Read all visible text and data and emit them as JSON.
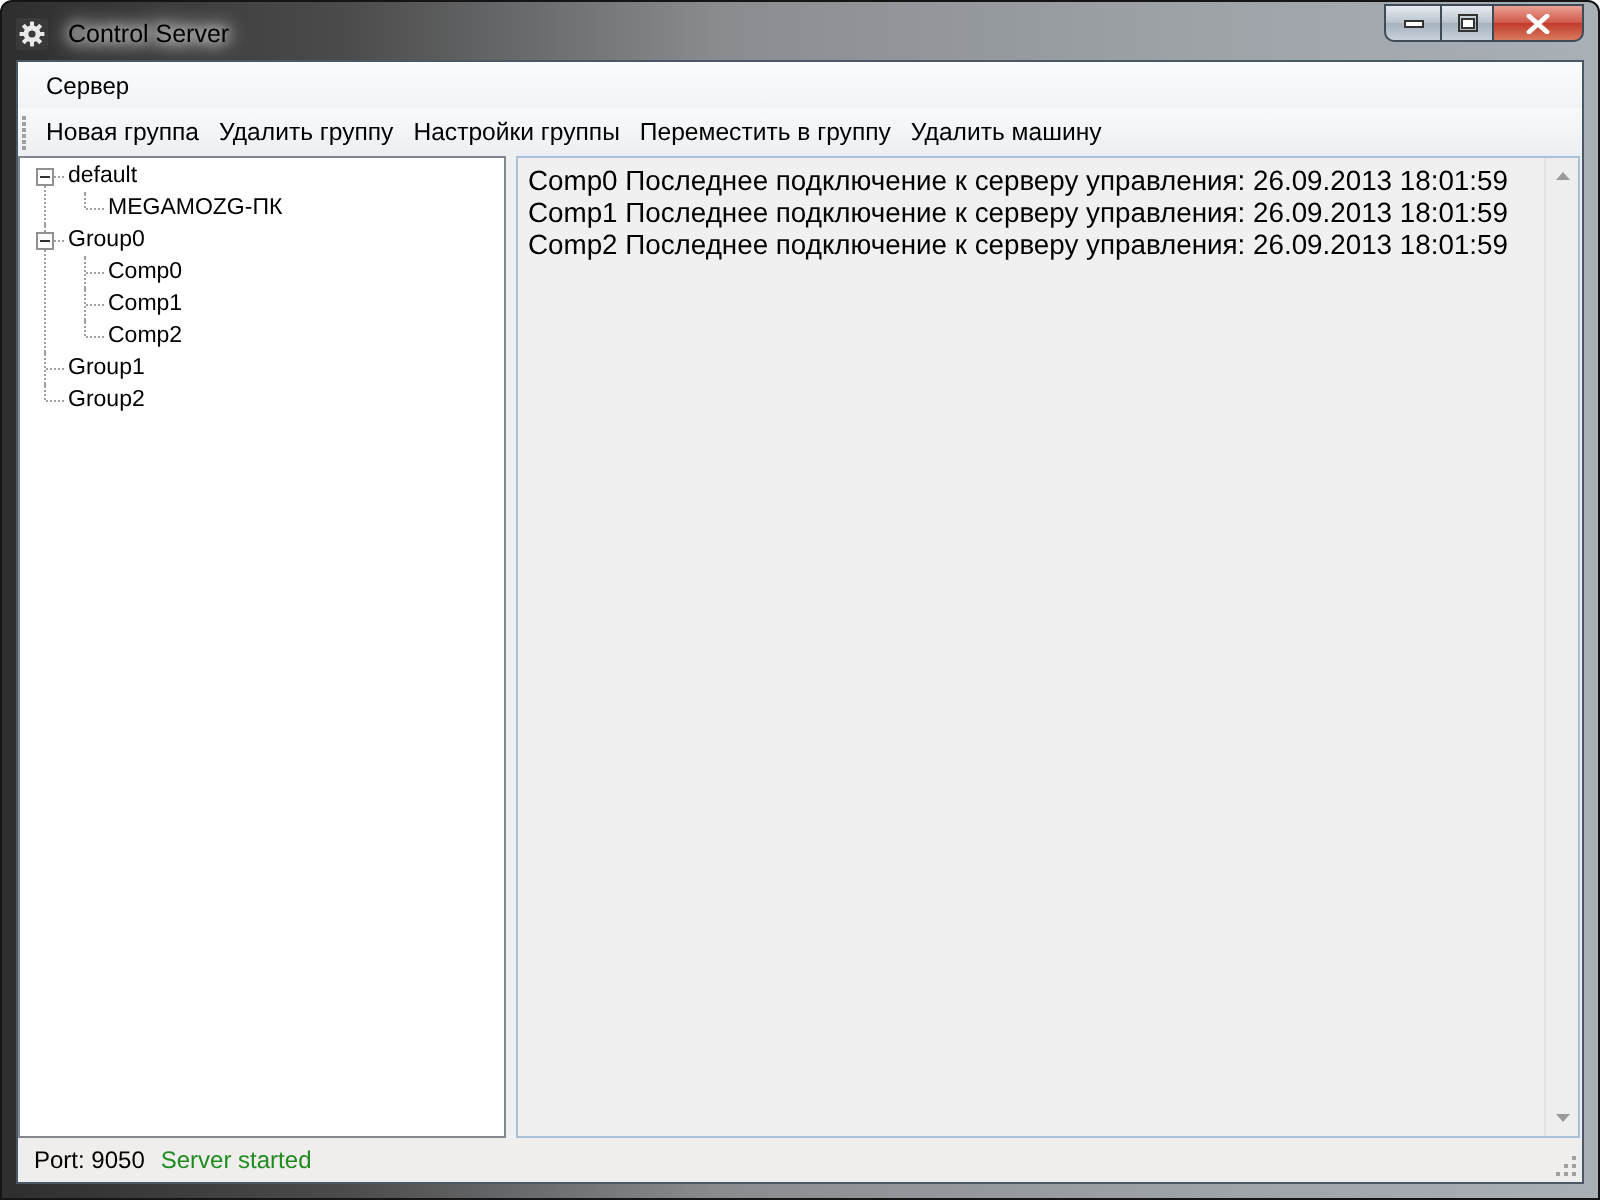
{
  "window": {
    "title": "Control Server"
  },
  "menu": [
    "Сервер"
  ],
  "toolbar": [
    "Новая группа",
    "Удалить группу",
    "Настройки группы",
    "Переместить в группу",
    "Удалить машину"
  ],
  "tree": {
    "items": [
      {
        "label": "default",
        "expanded": true,
        "children": [
          {
            "label": "MEGAMOZG-ПК"
          }
        ]
      },
      {
        "label": "Group0",
        "expanded": true,
        "children": [
          {
            "label": "Comp0"
          },
          {
            "label": "Comp1"
          },
          {
            "label": "Comp2"
          }
        ]
      },
      {
        "label": "Group1"
      },
      {
        "label": "Group2"
      }
    ]
  },
  "log": {
    "lines": [
      "Comp0 Последнее подключение к серверу управления: 26.09.2013 18:01:59",
      "Comp1 Последнее подключение к серверу управления: 26.09.2013 18:01:59",
      "Comp2 Последнее подключение к серверу управления: 26.09.2013 18:01:59"
    ]
  },
  "status_bar": {
    "items": [
      {
        "text": "Port: 9050",
        "color": "#000000"
      },
      {
        "text": "Server started",
        "color": "#1e8c1e"
      }
    ]
  }
}
